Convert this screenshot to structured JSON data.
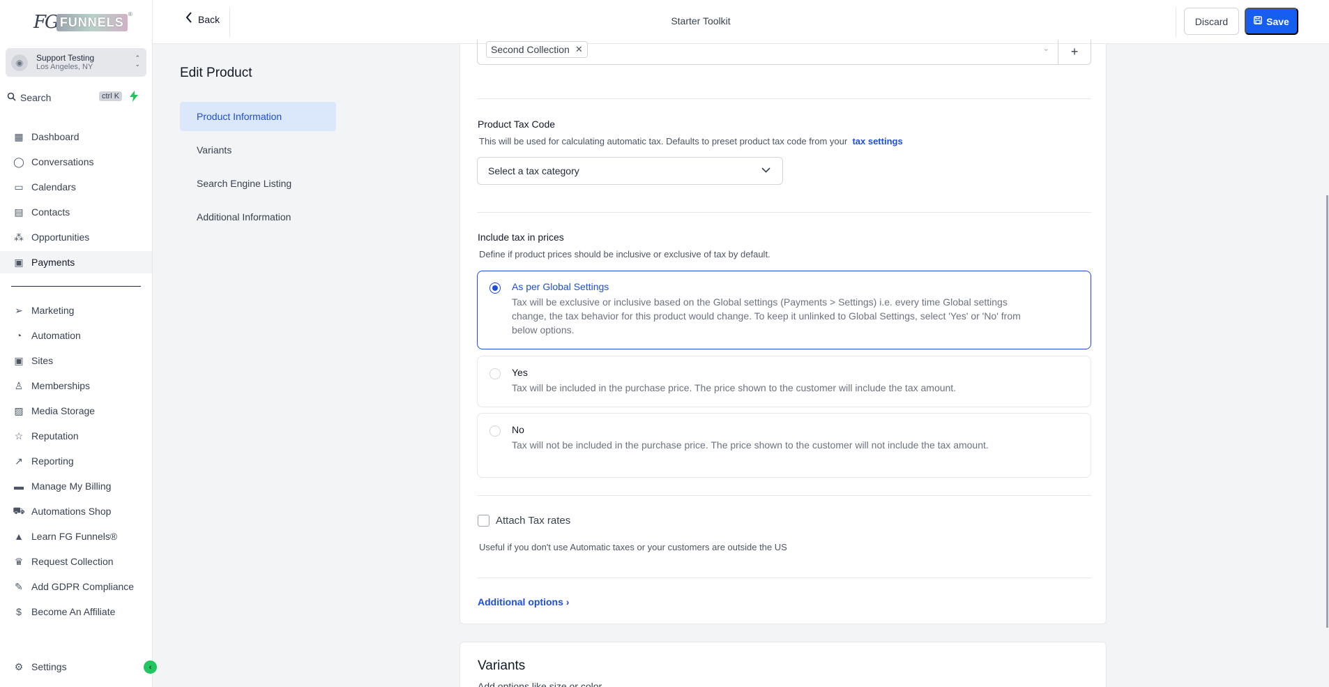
{
  "brand": {
    "fg": "FG",
    "funnels": "FUNNELS",
    "reg": "®"
  },
  "account": {
    "name": "Support Testing",
    "location": "Los Angeles, NY"
  },
  "search": {
    "label": "Search",
    "shortcut": "ctrl K"
  },
  "nav": [
    {
      "label": "Dashboard",
      "icon": "grid-icon"
    },
    {
      "label": "Conversations",
      "icon": "chat-icon"
    },
    {
      "label": "Calendars",
      "icon": "calendar-icon"
    },
    {
      "label": "Contacts",
      "icon": "contacts-icon"
    },
    {
      "label": "Opportunities",
      "icon": "opportunities-icon"
    },
    {
      "label": "Payments",
      "icon": "payments-icon",
      "active": true
    }
  ],
  "nav2": [
    {
      "label": "Marketing",
      "icon": "send-icon"
    },
    {
      "label": "Automation",
      "icon": "automation-icon"
    },
    {
      "label": "Sites",
      "icon": "sites-icon"
    },
    {
      "label": "Memberships",
      "icon": "memberships-icon"
    },
    {
      "label": "Media Storage",
      "icon": "image-icon"
    },
    {
      "label": "Reputation",
      "icon": "star-icon"
    },
    {
      "label": "Reporting",
      "icon": "trend-icon"
    },
    {
      "label": "Manage My Billing",
      "icon": "billing-icon"
    },
    {
      "label": "Automations Shop",
      "icon": "cart-icon"
    },
    {
      "label": "Learn FG Funnels®",
      "icon": "graduation-icon"
    },
    {
      "label": "Request Collection",
      "icon": "trophy-icon"
    },
    {
      "label": "Add GDPR Compliance",
      "icon": "signature-icon"
    },
    {
      "label": "Become An Affiliate",
      "icon": "dollar-icon"
    }
  ],
  "settings": {
    "label": "Settings"
  },
  "topbar": {
    "back": "Back",
    "title": "Starter Toolkit",
    "discard": "Discard",
    "save": "Save"
  },
  "edit": {
    "title": "Edit Product",
    "sections": [
      "Product Information",
      "Variants",
      "Search Engine Listing",
      "Additional Information"
    ]
  },
  "form": {
    "collection_chip": "Second Collection",
    "tax_code_label": "Product Tax Code",
    "tax_code_help": "This will be used for calculating automatic tax. Defaults to preset product tax code from your",
    "tax_settings_link": "tax settings",
    "tax_select_placeholder": "Select a tax category",
    "include_tax_label": "Include tax in prices",
    "include_tax_help": "Define if product prices should be inclusive or exclusive of tax by default.",
    "options": [
      {
        "title": "As per Global Settings",
        "desc": "Tax will be exclusive or inclusive based on the Global settings (Payments > Settings) i.e. every time Global settings change, the tax behavior for this product would change. To keep it unlinked to Global Settings, select 'Yes' or 'No' from below options.",
        "selected": true
      },
      {
        "title": "Yes",
        "desc": "Tax will be included in the purchase price. The price shown to the customer will include the tax amount.",
        "selected": false
      },
      {
        "title": "No",
        "desc": "Tax will not be included in the purchase price. The price shown to the customer will not include the tax amount.",
        "selected": false
      }
    ],
    "attach_tax_label": "Attach Tax rates",
    "attach_tax_help": "Useful if you don't use Automatic taxes or your customers are outside the US",
    "additional_options": "Additional options"
  },
  "variants_card": {
    "title": "Variants",
    "subtitle": "Add options like size or color"
  }
}
